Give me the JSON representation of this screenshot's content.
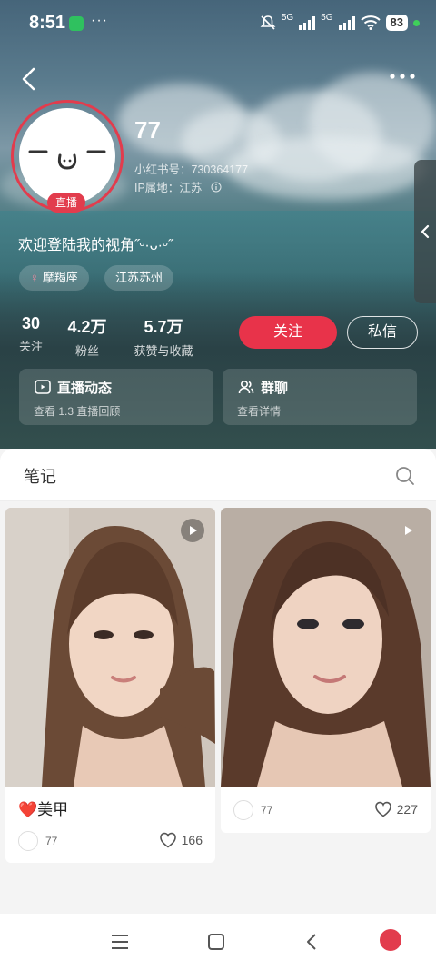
{
  "status_bar": {
    "time": "8:51",
    "more": "···",
    "network1": "5G",
    "network2": "5G",
    "battery": "83"
  },
  "profile": {
    "nickname": "77",
    "id_label": "小红书号：",
    "id_value": "730364177",
    "ip_label": "IP属地：",
    "ip_value": "江苏",
    "live_badge": "直播",
    "bio": "欢迎登陆我的视角˝ᵕ·ᴗ·ᵕ˝",
    "tags": [
      "摩羯座",
      "江苏苏州"
    ],
    "stats": [
      {
        "value": "30",
        "label": "关注"
      },
      {
        "value": "4.2万",
        "label": "粉丝"
      },
      {
        "value": "5.7万",
        "label": "获赞与收藏"
      }
    ],
    "follow_label": "关注",
    "message_label": "私信",
    "cards": [
      {
        "title": "直播动态",
        "subtitle": "查看 1.3 直播回顾",
        "icon": "live-play-icon"
      },
      {
        "title": "群聊",
        "subtitle": "查看详情",
        "icon": "group-icon"
      }
    ]
  },
  "notes": {
    "tab_title": "笔记",
    "posts": [
      {
        "title": "❤️美甲",
        "author": "77",
        "likes": "166",
        "is_video": true
      },
      {
        "title": "",
        "author": "77",
        "likes": "227",
        "is_video": true
      }
    ]
  },
  "colors": {
    "accent": "#e8334a",
    "avatar_ring": "#e23c4d"
  }
}
